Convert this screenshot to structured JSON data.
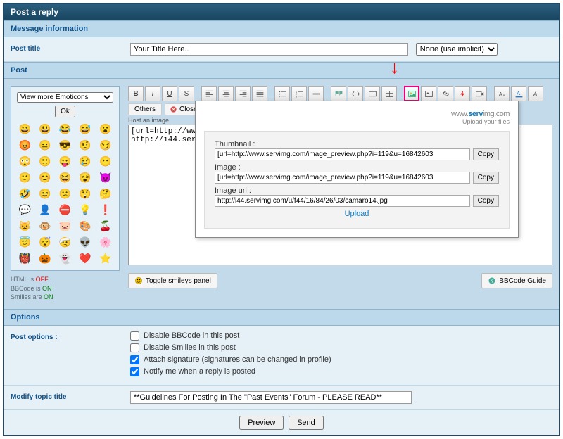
{
  "header": {
    "title": "Post a reply"
  },
  "sections": {
    "message_info": "Message information",
    "post": "Post",
    "options": "Options"
  },
  "title_row": {
    "label": "Post title",
    "value": "Your Title Here..",
    "implicit_selected": "None (use implicit)"
  },
  "smileys": {
    "dropdown": "View more Emoticons",
    "ok": "Ok",
    "status1a": "HTML is ",
    "status1b": "OFF",
    "status2a": "BBCode is ",
    "status2b": "ON",
    "status3a": "Smilies are ",
    "status3b": "ON"
  },
  "toolbar2": {
    "others": "Others",
    "close_tags": "Close Tags"
  },
  "host_label": "Host an image",
  "textarea_value": "[url=http://www.servimg.com/image_preview.php?i=119&u=16842603\nhttp://i44.servimg.com/u/f44/16/84/26/03/camaro14.jpg",
  "popup": {
    "brand_prefix": "www.",
    "brand_mid": "serv",
    "brand_suffix": "img.com",
    "subtitle": "Upload your files",
    "thumb_label": "Thumbnail :",
    "thumb_value": "[url=http://www.servimg.com/image_preview.php?i=119&u=16842603",
    "image_label": "Image :",
    "image_value": "[url=http://www.servimg.com/image_preview.php?i=119&u=16842603",
    "url_label": "Image url :",
    "url_value": "http://i44.servimg.com/u/f44/16/84/26/03/camaro14.jpg",
    "copy": "Copy",
    "upload": "Upload"
  },
  "bottom": {
    "toggle": "Toggle smileys panel",
    "guide": "BBCode Guide"
  },
  "options": {
    "label": "Post options :",
    "opt1": "Disable BBCode in this post",
    "opt2": "Disable Smilies in this post",
    "opt3": "Attach signature (signatures can be changed in profile)",
    "opt4": "Notify me when a reply is posted"
  },
  "modify": {
    "label": "Modify topic title",
    "value": "**Guidelines For Posting In The \"Past Events\" Forum - PLEASE READ**"
  },
  "submit": {
    "preview": "Preview",
    "send": "Send"
  }
}
